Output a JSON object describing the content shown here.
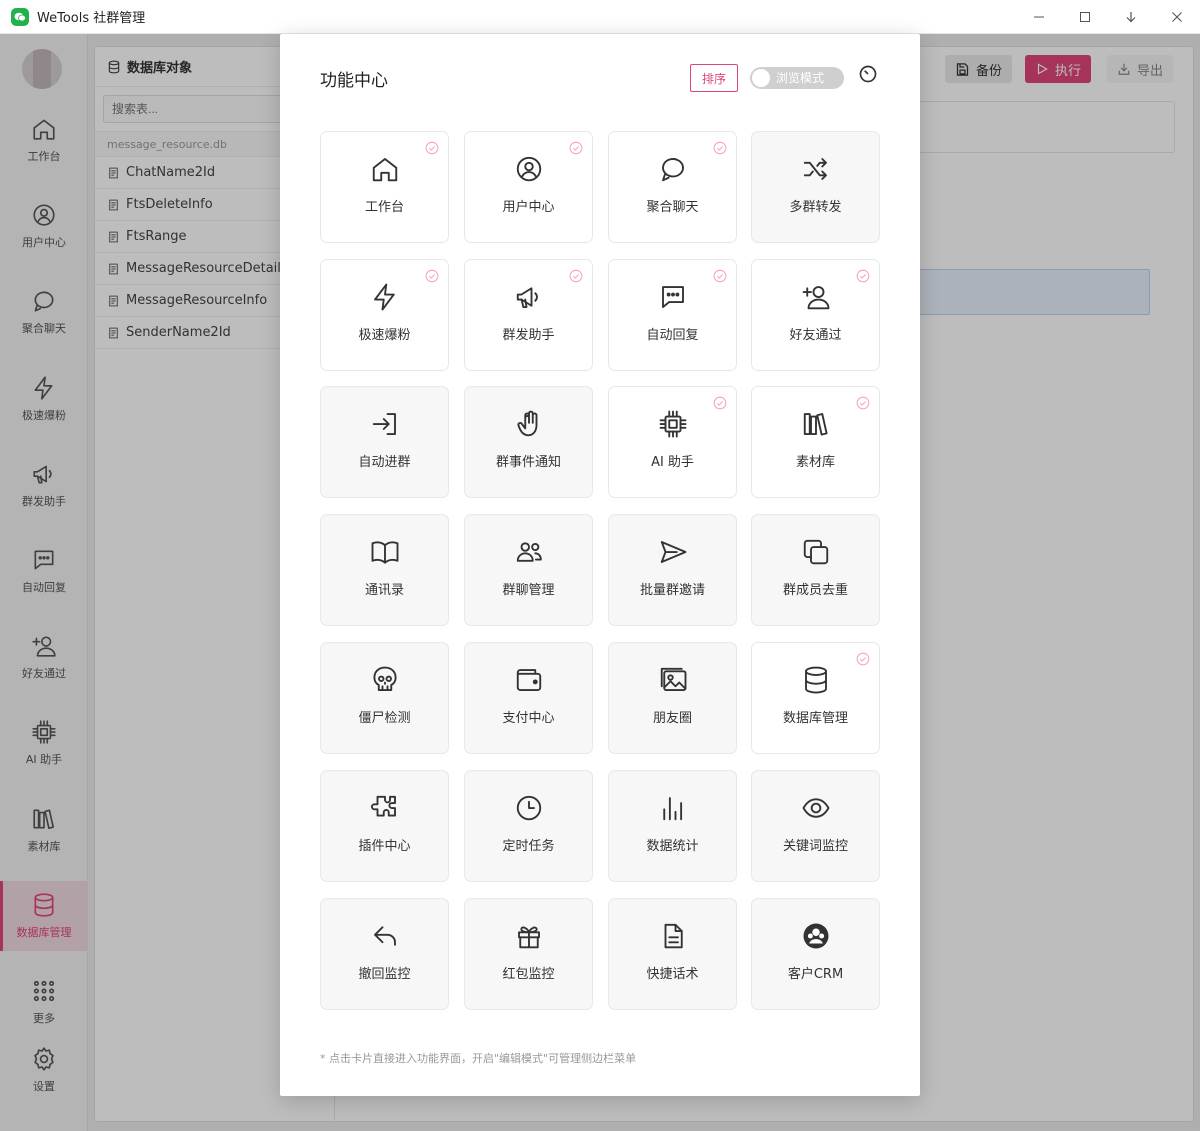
{
  "window": {
    "title": "WeTools 社群管理"
  },
  "sidebar": {
    "items": [
      {
        "label": "工作台",
        "icon": "home-icon"
      },
      {
        "label": "用户中心",
        "icon": "user-icon"
      },
      {
        "label": "聚合聊天",
        "icon": "chat-icon"
      },
      {
        "label": "极速爆粉",
        "icon": "bolt-icon"
      },
      {
        "label": "群发助手",
        "icon": "megaphone-icon"
      },
      {
        "label": "自动回复",
        "icon": "message-icon"
      },
      {
        "label": "好友通过",
        "icon": "user-add-icon"
      },
      {
        "label": "AI 助手",
        "icon": "chip-icon"
      },
      {
        "label": "素材库",
        "icon": "library-icon"
      },
      {
        "label": "数据库管理",
        "icon": "database-icon"
      },
      {
        "label": "更多",
        "icon": "grid-icon"
      },
      {
        "label": "设置",
        "icon": "gear-icon"
      }
    ],
    "active_index": 9
  },
  "db_panel": {
    "title": "数据库对象",
    "search_placeholder": "搜索表...",
    "file": "message_resource.db",
    "tables": [
      "ChatName2Id",
      "FtsDeleteInfo",
      "FtsRange",
      "MessageResourceDetail",
      "MessageResourceInfo",
      "SenderName2Id"
    ]
  },
  "toolbar": {
    "backup": "备份",
    "run": "执行",
    "export": "导出"
  },
  "modal": {
    "title": "功能中心",
    "sort_label": "排序",
    "toggle_label": "浏览模式",
    "footnote": "* 点击卡片直接进入功能界面，开启\"编辑模式\"可管理侧边栏菜单",
    "cards": [
      {
        "label": "工作台",
        "icon": "home-icon",
        "pinned": true
      },
      {
        "label": "用户中心",
        "icon": "user-icon",
        "pinned": true
      },
      {
        "label": "聚合聊天",
        "icon": "chat-icon",
        "pinned": true
      },
      {
        "label": "多群转发",
        "icon": "shuffle-icon",
        "pinned": false
      },
      {
        "label": "极速爆粉",
        "icon": "bolt-icon",
        "pinned": true
      },
      {
        "label": "群发助手",
        "icon": "megaphone-icon",
        "pinned": true
      },
      {
        "label": "自动回复",
        "icon": "message-icon",
        "pinned": true
      },
      {
        "label": "好友通过",
        "icon": "user-add-icon",
        "pinned": true
      },
      {
        "label": "自动进群",
        "icon": "login-icon",
        "pinned": false
      },
      {
        "label": "群事件通知",
        "icon": "hand-icon",
        "pinned": false
      },
      {
        "label": "AI 助手",
        "icon": "chip-icon",
        "pinned": true
      },
      {
        "label": "素材库",
        "icon": "library-icon",
        "pinned": true
      },
      {
        "label": "通讯录",
        "icon": "book-icon",
        "pinned": false
      },
      {
        "label": "群聊管理",
        "icon": "users-icon",
        "pinned": false
      },
      {
        "label": "批量群邀请",
        "icon": "send-icon",
        "pinned": false
      },
      {
        "label": "群成员去重",
        "icon": "copy-icon",
        "pinned": false
      },
      {
        "label": "僵尸检测",
        "icon": "skull-icon",
        "pinned": false
      },
      {
        "label": "支付中心",
        "icon": "wallet-icon",
        "pinned": false
      },
      {
        "label": "朋友圈",
        "icon": "image-icon",
        "pinned": false
      },
      {
        "label": "数据库管理",
        "icon": "database-icon",
        "pinned": true
      },
      {
        "label": "插件中心",
        "icon": "puzzle-icon",
        "pinned": false
      },
      {
        "label": "定时任务",
        "icon": "clock-icon",
        "pinned": false
      },
      {
        "label": "数据统计",
        "icon": "chart-icon",
        "pinned": false
      },
      {
        "label": "关键词监控",
        "icon": "eye-icon",
        "pinned": false
      },
      {
        "label": "撤回监控",
        "icon": "undo-icon",
        "pinned": false
      },
      {
        "label": "红包监控",
        "icon": "gift-icon",
        "pinned": false
      },
      {
        "label": "快捷话术",
        "icon": "document-icon",
        "pinned": false
      },
      {
        "label": "客户CRM",
        "icon": "crm-icon",
        "pinned": false
      }
    ]
  },
  "colors": {
    "accent": "#e0457a",
    "brand": "#22b14c"
  }
}
